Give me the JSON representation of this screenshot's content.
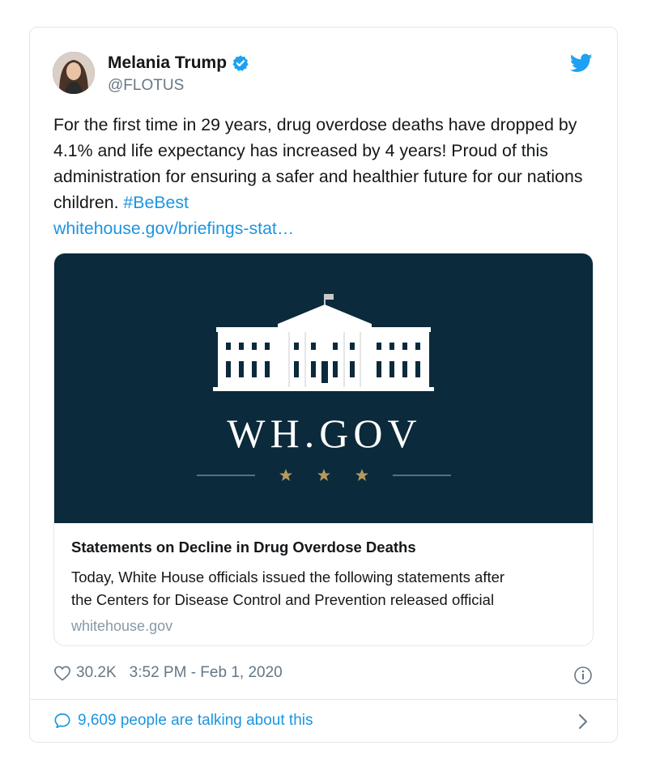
{
  "author": {
    "name": "Melania Trump",
    "handle": "@FLOTUS",
    "avatar_icon": "profile-photo"
  },
  "tweet": {
    "text_main": "For the first time in 29 years, drug overdose deaths have dropped by 4.1% and life expectancy has increased by 4 years! Proud of this administration for ensuring a safer and healthier future for our nations children.",
    "hashtag": "#BeBest",
    "link": "whitehouse.gov/briefings-stat…"
  },
  "card": {
    "logo_text": "WH.GOV",
    "title": "Statements on Decline in Drug Overdose Deaths",
    "description_line1": "Today, White House officials issued the following statements after",
    "description_line2": "the Centers for Disease Control and Prevention released official",
    "domain": "whitehouse.gov"
  },
  "meta": {
    "likes": "30.2K",
    "timestamp": "3:52 PM - Feb 1, 2020"
  },
  "footer": {
    "talking": "9,609 people are talking about this"
  },
  "colors": {
    "twitter_blue": "#1b95e0",
    "card_bg": "#0b2a3b",
    "gold": "#b49a5f"
  }
}
